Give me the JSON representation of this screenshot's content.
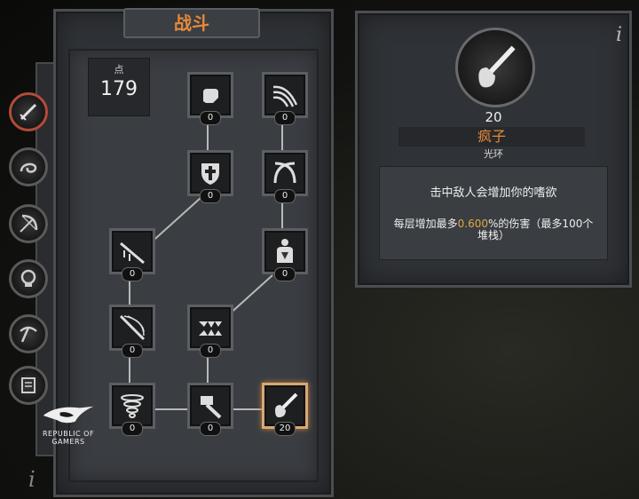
{
  "skill_panel": {
    "title": "战斗",
    "points_label": "点",
    "points_value": "179"
  },
  "nodes": [
    {
      "name": "fist",
      "level": "0"
    },
    {
      "name": "claw",
      "level": "0"
    },
    {
      "name": "shield-cross",
      "level": "0"
    },
    {
      "name": "crossed-blades",
      "level": "0"
    },
    {
      "name": "bleeding-sword",
      "level": "0"
    },
    {
      "name": "body",
      "level": "0"
    },
    {
      "name": "sword-slash",
      "level": "0"
    },
    {
      "name": "fangs",
      "level": "0"
    },
    {
      "name": "whirlwind",
      "level": "0"
    },
    {
      "name": "hammer",
      "level": "0"
    },
    {
      "name": "frenzy",
      "level": "20"
    }
  ],
  "detail": {
    "info_icon": "i",
    "level": "20",
    "name": "疯子",
    "type": "光环",
    "desc_line1": "击中敌人会增加你的嗜欲",
    "desc_line2_pre": "每层增加最多",
    "desc_line2_value": "0.600",
    "desc_line2_post": "%的伤害（最多100个堆栈）"
  },
  "tabs": [
    "sword-tab",
    "serpent-tab",
    "bow-tab",
    "skull-tab",
    "pickaxe-tab",
    "scroll-tab"
  ],
  "brand": {
    "logo_text_1": "REPUBLIC OF",
    "logo_text_2": "GAMERS"
  },
  "bottom_info": "i",
  "colors": {
    "accent": "#e58a3a",
    "highlight": "#e0a840",
    "active_border": "#d8a874"
  }
}
